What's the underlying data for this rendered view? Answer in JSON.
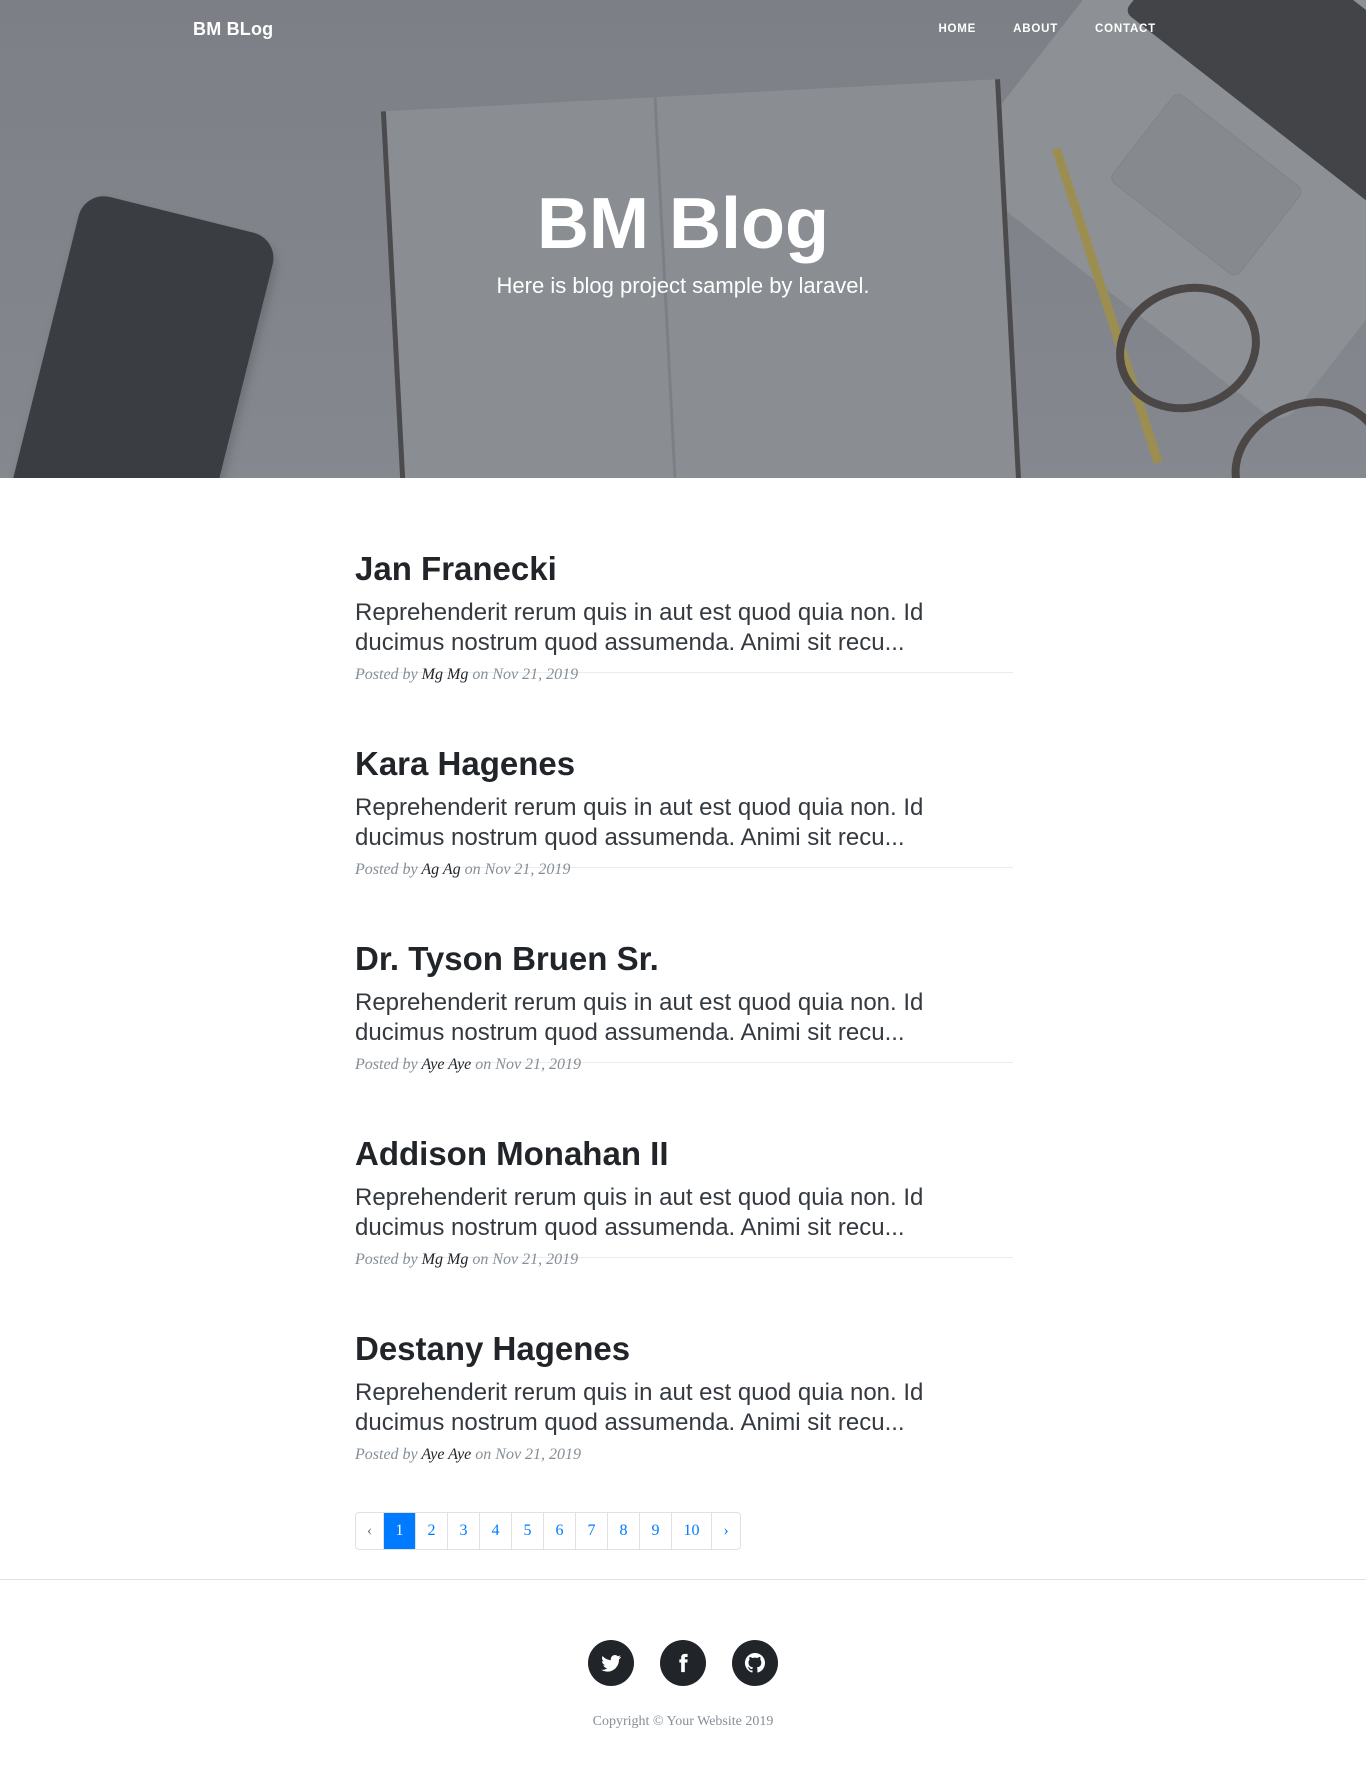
{
  "nav": {
    "brand": "BM BLog",
    "links": [
      "HOME",
      "ABOUT",
      "CONTACT"
    ]
  },
  "hero": {
    "title": "BM Blog",
    "subtitle": "Here is blog project sample by laravel."
  },
  "posts": [
    {
      "title": "Jan Franecki",
      "excerpt": "Reprehenderit rerum quis in aut est quod quia non. Id ducimus nostrum quod assumenda. Animi sit recu...",
      "meta_prefix": "Posted by",
      "author": "Mg Mg",
      "meta_on": "on",
      "date": "Nov 21, 2019"
    },
    {
      "title": "Kara Hagenes",
      "excerpt": "Reprehenderit rerum quis in aut est quod quia non. Id ducimus nostrum quod assumenda. Animi sit recu...",
      "meta_prefix": "Posted by",
      "author": "Ag Ag",
      "meta_on": "on",
      "date": "Nov 21, 2019"
    },
    {
      "title": "Dr. Tyson Bruen Sr.",
      "excerpt": "Reprehenderit rerum quis in aut est quod quia non. Id ducimus nostrum quod assumenda. Animi sit recu...",
      "meta_prefix": "Posted by",
      "author": "Aye Aye",
      "meta_on": "on",
      "date": "Nov 21, 2019"
    },
    {
      "title": "Addison Monahan II",
      "excerpt": "Reprehenderit rerum quis in aut est quod quia non. Id ducimus nostrum quod assumenda. Animi sit recu...",
      "meta_prefix": "Posted by",
      "author": "Mg Mg",
      "meta_on": "on",
      "date": "Nov 21, 2019"
    },
    {
      "title": "Destany Hagenes",
      "excerpt": "Reprehenderit rerum quis in aut est quod quia non. Id ducimus nostrum quod assumenda. Animi sit recu...",
      "meta_prefix": "Posted by",
      "author": "Aye Aye",
      "meta_on": "on",
      "date": "Nov 21, 2019"
    }
  ],
  "pagination": {
    "prev": "‹",
    "next": "›",
    "pages": [
      "1",
      "2",
      "3",
      "4",
      "5",
      "6",
      "7",
      "8",
      "9",
      "10"
    ],
    "active_page": "1"
  },
  "footer": {
    "social_icons": [
      "twitter-icon",
      "facebook-icon",
      "github-icon"
    ],
    "copyright": "Copyright © Your Website 2019"
  },
  "colors": {
    "link": "#007bff",
    "dark": "#212529",
    "muted": "#868e96"
  }
}
